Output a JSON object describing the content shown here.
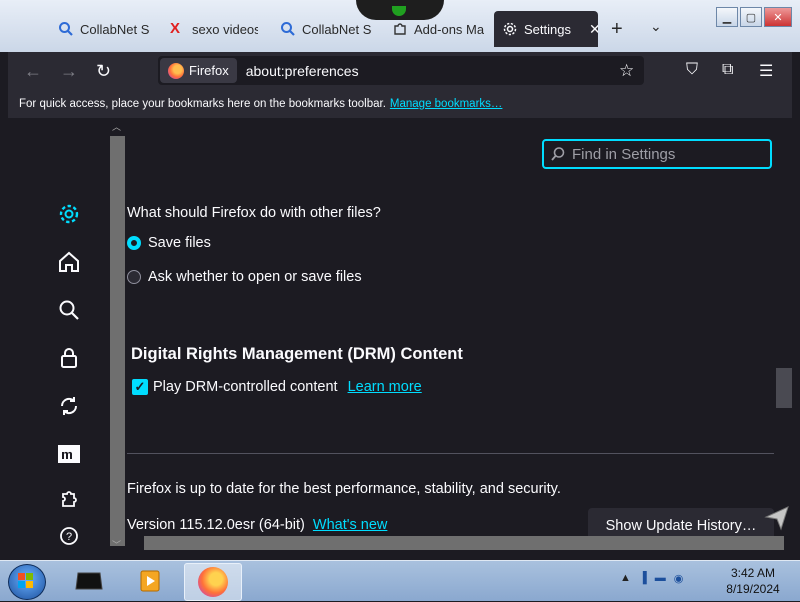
{
  "browser": {
    "tabs": [
      {
        "title": "CollabNet Sc",
        "icon": "search-icon"
      },
      {
        "title": "sexo videos",
        "icon": "x-site-icon"
      },
      {
        "title": "CollabNet Sc",
        "icon": "search-icon"
      },
      {
        "title": "Add-ons Ma",
        "icon": "puzzle-icon"
      },
      {
        "title": "Settings",
        "icon": "gear-icon",
        "active": true
      }
    ],
    "identity_label": "Firefox",
    "url": "about:preferences",
    "bookmarks_message": "For quick access, place your bookmarks here on the bookmarks toolbar.",
    "bookmarks_link": "Manage bookmarks…",
    "window_buttons": [
      "minimize",
      "maximize",
      "close"
    ]
  },
  "settings": {
    "search_placeholder": "Find in Settings",
    "categories": [
      "gear-icon",
      "home-icon",
      "search-icon",
      "lock-icon",
      "sync-icon",
      "mozilla-icon",
      "extensions-icon",
      "help-icon"
    ],
    "other_files_question": "What should Firefox do with other files?",
    "radio_save": "Save files",
    "radio_ask": "Ask whether to open or save files",
    "selected_radio": "save",
    "drm_heading": "Digital Rights Management (DRM) Content",
    "drm_checkbox": "Play DRM-controlled content",
    "drm_checked": true,
    "drm_learn_more": "Learn more",
    "update_status": "Firefox is up to date for the best performance, stability, and security.",
    "version": "Version 115.12.0esr (64-bit)",
    "whats_new": "What's new",
    "show_update_history": "Show Update History…"
  },
  "taskbar": {
    "time": "3:42 AM",
    "date": "8/19/2024"
  },
  "colors": {
    "accent": "#00ddff",
    "background": "#1c1b22",
    "toolbar": "#2b2a33"
  }
}
